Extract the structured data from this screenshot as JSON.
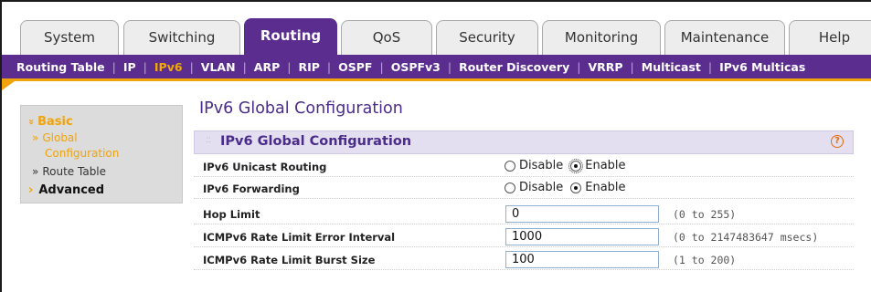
{
  "top_tabs": [
    {
      "label": "System",
      "active": false
    },
    {
      "label": "Switching",
      "active": false
    },
    {
      "label": "Routing",
      "active": true
    },
    {
      "label": "QoS",
      "active": false
    },
    {
      "label": "Security",
      "active": false
    },
    {
      "label": "Monitoring",
      "active": false
    },
    {
      "label": "Maintenance",
      "active": false
    },
    {
      "label": "Help",
      "active": false
    }
  ],
  "sub_nav": [
    {
      "label": "Routing Table",
      "active": false
    },
    {
      "label": "IP",
      "active": false
    },
    {
      "label": "IPv6",
      "active": true
    },
    {
      "label": "VLAN",
      "active": false
    },
    {
      "label": "ARP",
      "active": false
    },
    {
      "label": "RIP",
      "active": false
    },
    {
      "label": "OSPF",
      "active": false
    },
    {
      "label": "OSPFv3",
      "active": false
    },
    {
      "label": "Router Discovery",
      "active": false
    },
    {
      "label": "VRRP",
      "active": false
    },
    {
      "label": "Multicast",
      "active": false
    },
    {
      "label": "IPv6 Multicas",
      "active": false
    }
  ],
  "left_nav": {
    "basic": {
      "arrow": "»",
      "label": "Basic"
    },
    "global_config": {
      "arrow": "»",
      "label": "Global",
      "label2": "Configuration"
    },
    "route_table": {
      "arrow": "»",
      "label": "Route Table"
    },
    "advanced": {
      "arrow": "›",
      "label": "Advanced"
    }
  },
  "page": {
    "title": "IPv6 Global Configuration"
  },
  "section": {
    "title": "IPv6 Global Configuration",
    "help_symbol": "?"
  },
  "fields": {
    "unicast_routing": {
      "label": "IPv6 Unicast Routing",
      "disable_label": "Disable",
      "enable_label": "Enable",
      "selected": "Enable"
    },
    "forwarding": {
      "label": "IPv6 Forwarding",
      "disable_label": "Disable",
      "enable_label": "Enable",
      "selected": "Enable"
    },
    "hop_limit": {
      "label": "Hop Limit",
      "value": "0",
      "hint": "(0 to 255)"
    },
    "error_interval": {
      "label": "ICMPv6 Rate Limit Error Interval",
      "value": "1000",
      "hint": "(0 to 2147483647 msecs)"
    },
    "burst_size": {
      "label": "ICMPv6 Rate Limit Burst Size",
      "value": "100",
      "hint": "(1 to 200)"
    }
  },
  "colors": {
    "brand_purple": "#5b2d8f",
    "accent_orange": "#f0a30a",
    "active_sub_nav": "#f2a900"
  }
}
